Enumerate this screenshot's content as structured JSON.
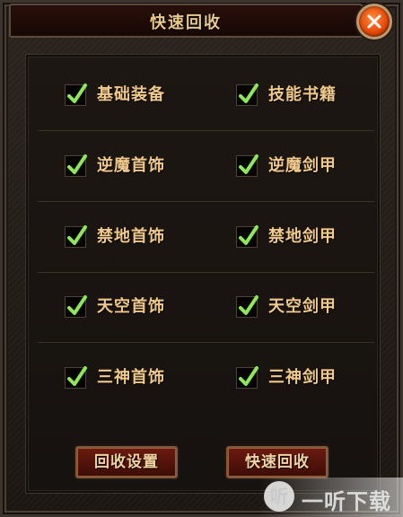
{
  "window": {
    "title": "快速回收",
    "close_glyph": "✕"
  },
  "options": [
    {
      "left": "基础装备",
      "right": "技能书籍",
      "left_checked": true,
      "right_checked": true
    },
    {
      "left": "逆魔首饰",
      "right": "逆魔剑甲",
      "left_checked": true,
      "right_checked": true
    },
    {
      "left": "禁地首饰",
      "right": "禁地剑甲",
      "left_checked": true,
      "right_checked": true
    },
    {
      "left": "天空首饰",
      "right": "天空剑甲",
      "left_checked": true,
      "right_checked": true
    },
    {
      "left": "三神首饰",
      "right": "三神剑甲",
      "left_checked": true,
      "right_checked": true
    }
  ],
  "buttons": {
    "settings": "回收设置",
    "quick": "快速回收"
  },
  "watermark": {
    "logo": "听",
    "text": "一听下载"
  },
  "colors": {
    "label": "#f0c98b",
    "check": "#8ee65a",
    "close": "#e64a09"
  }
}
